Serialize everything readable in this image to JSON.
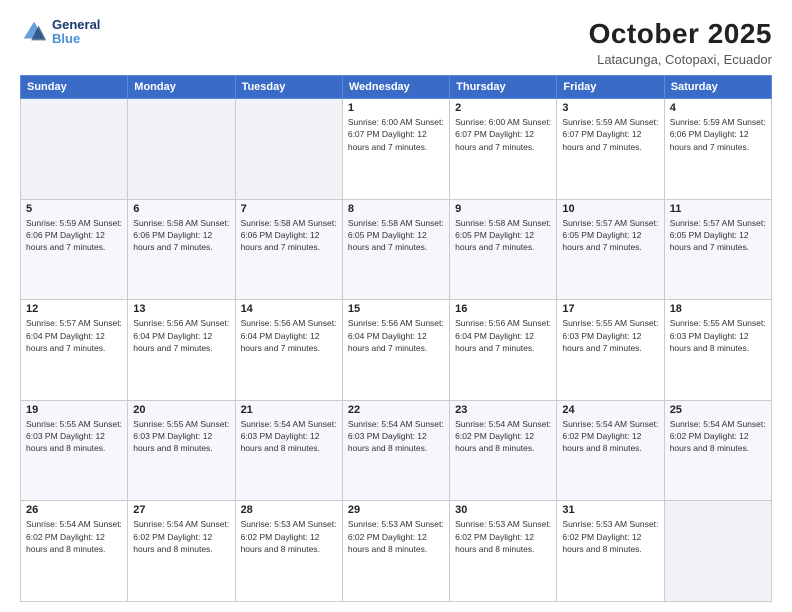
{
  "header": {
    "logo_general": "General",
    "logo_blue": "Blue",
    "title": "October 2025",
    "location": "Latacunga, Cotopaxi, Ecuador"
  },
  "calendar": {
    "days_of_week": [
      "Sunday",
      "Monday",
      "Tuesday",
      "Wednesday",
      "Thursday",
      "Friday",
      "Saturday"
    ],
    "weeks": [
      [
        {
          "day": "",
          "text": ""
        },
        {
          "day": "",
          "text": ""
        },
        {
          "day": "",
          "text": ""
        },
        {
          "day": "1",
          "text": "Sunrise: 6:00 AM\nSunset: 6:07 PM\nDaylight: 12 hours\nand 7 minutes."
        },
        {
          "day": "2",
          "text": "Sunrise: 6:00 AM\nSunset: 6:07 PM\nDaylight: 12 hours\nand 7 minutes."
        },
        {
          "day": "3",
          "text": "Sunrise: 5:59 AM\nSunset: 6:07 PM\nDaylight: 12 hours\nand 7 minutes."
        },
        {
          "day": "4",
          "text": "Sunrise: 5:59 AM\nSunset: 6:06 PM\nDaylight: 12 hours\nand 7 minutes."
        }
      ],
      [
        {
          "day": "5",
          "text": "Sunrise: 5:59 AM\nSunset: 6:06 PM\nDaylight: 12 hours\nand 7 minutes."
        },
        {
          "day": "6",
          "text": "Sunrise: 5:58 AM\nSunset: 6:06 PM\nDaylight: 12 hours\nand 7 minutes."
        },
        {
          "day": "7",
          "text": "Sunrise: 5:58 AM\nSunset: 6:06 PM\nDaylight: 12 hours\nand 7 minutes."
        },
        {
          "day": "8",
          "text": "Sunrise: 5:58 AM\nSunset: 6:05 PM\nDaylight: 12 hours\nand 7 minutes."
        },
        {
          "day": "9",
          "text": "Sunrise: 5:58 AM\nSunset: 6:05 PM\nDaylight: 12 hours\nand 7 minutes."
        },
        {
          "day": "10",
          "text": "Sunrise: 5:57 AM\nSunset: 6:05 PM\nDaylight: 12 hours\nand 7 minutes."
        },
        {
          "day": "11",
          "text": "Sunrise: 5:57 AM\nSunset: 6:05 PM\nDaylight: 12 hours\nand 7 minutes."
        }
      ],
      [
        {
          "day": "12",
          "text": "Sunrise: 5:57 AM\nSunset: 6:04 PM\nDaylight: 12 hours\nand 7 minutes."
        },
        {
          "day": "13",
          "text": "Sunrise: 5:56 AM\nSunset: 6:04 PM\nDaylight: 12 hours\nand 7 minutes."
        },
        {
          "day": "14",
          "text": "Sunrise: 5:56 AM\nSunset: 6:04 PM\nDaylight: 12 hours\nand 7 minutes."
        },
        {
          "day": "15",
          "text": "Sunrise: 5:56 AM\nSunset: 6:04 PM\nDaylight: 12 hours\nand 7 minutes."
        },
        {
          "day": "16",
          "text": "Sunrise: 5:56 AM\nSunset: 6:04 PM\nDaylight: 12 hours\nand 7 minutes."
        },
        {
          "day": "17",
          "text": "Sunrise: 5:55 AM\nSunset: 6:03 PM\nDaylight: 12 hours\nand 7 minutes."
        },
        {
          "day": "18",
          "text": "Sunrise: 5:55 AM\nSunset: 6:03 PM\nDaylight: 12 hours\nand 8 minutes."
        }
      ],
      [
        {
          "day": "19",
          "text": "Sunrise: 5:55 AM\nSunset: 6:03 PM\nDaylight: 12 hours\nand 8 minutes."
        },
        {
          "day": "20",
          "text": "Sunrise: 5:55 AM\nSunset: 6:03 PM\nDaylight: 12 hours\nand 8 minutes."
        },
        {
          "day": "21",
          "text": "Sunrise: 5:54 AM\nSunset: 6:03 PM\nDaylight: 12 hours\nand 8 minutes."
        },
        {
          "day": "22",
          "text": "Sunrise: 5:54 AM\nSunset: 6:03 PM\nDaylight: 12 hours\nand 8 minutes."
        },
        {
          "day": "23",
          "text": "Sunrise: 5:54 AM\nSunset: 6:02 PM\nDaylight: 12 hours\nand 8 minutes."
        },
        {
          "day": "24",
          "text": "Sunrise: 5:54 AM\nSunset: 6:02 PM\nDaylight: 12 hours\nand 8 minutes."
        },
        {
          "day": "25",
          "text": "Sunrise: 5:54 AM\nSunset: 6:02 PM\nDaylight: 12 hours\nand 8 minutes."
        }
      ],
      [
        {
          "day": "26",
          "text": "Sunrise: 5:54 AM\nSunset: 6:02 PM\nDaylight: 12 hours\nand 8 minutes."
        },
        {
          "day": "27",
          "text": "Sunrise: 5:54 AM\nSunset: 6:02 PM\nDaylight: 12 hours\nand 8 minutes."
        },
        {
          "day": "28",
          "text": "Sunrise: 5:53 AM\nSunset: 6:02 PM\nDaylight: 12 hours\nand 8 minutes."
        },
        {
          "day": "29",
          "text": "Sunrise: 5:53 AM\nSunset: 6:02 PM\nDaylight: 12 hours\nand 8 minutes."
        },
        {
          "day": "30",
          "text": "Sunrise: 5:53 AM\nSunset: 6:02 PM\nDaylight: 12 hours\nand 8 minutes."
        },
        {
          "day": "31",
          "text": "Sunrise: 5:53 AM\nSunset: 6:02 PM\nDaylight: 12 hours\nand 8 minutes."
        },
        {
          "day": "",
          "text": ""
        }
      ]
    ]
  }
}
